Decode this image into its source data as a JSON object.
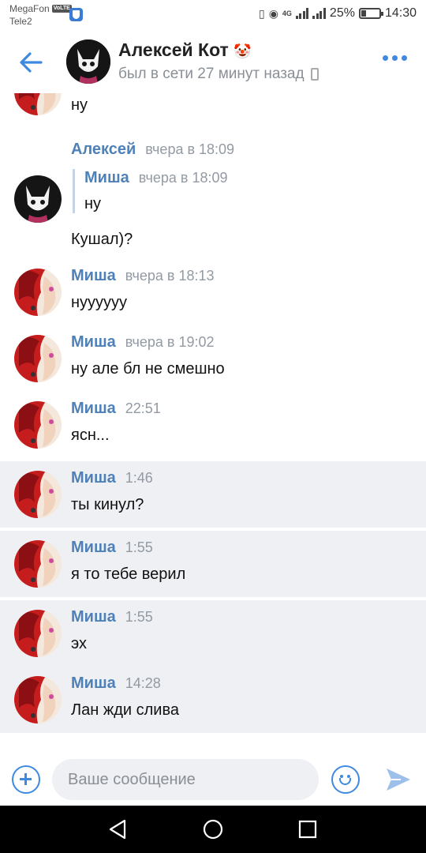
{
  "status_bar": {
    "carrier1": "MegaFon",
    "carrier1_badge": "VoLTE",
    "carrier2": "Tele2",
    "network": "4G",
    "battery_text": "25%",
    "battery_level": 0.25,
    "time": "14:30"
  },
  "header": {
    "name": "Алексей Кот",
    "emoji": "🤡",
    "status": "был в сети 27 минут назад"
  },
  "messages": [
    {
      "type": "continuation",
      "text": "ну",
      "avatar": "misha",
      "unread": false
    },
    {
      "type": "message",
      "author": "Алексей",
      "time": "вчера в 18:09",
      "avatar": "aleksey",
      "unread": false,
      "quote": {
        "author": "Миша",
        "time": "вчера в 18:09",
        "text": "ну"
      },
      "text": "Кушал)?"
    },
    {
      "type": "message",
      "author": "Миша",
      "time": "вчера в 18:13",
      "text": "нуууууу",
      "avatar": "misha",
      "unread": false
    },
    {
      "type": "message",
      "author": "Миша",
      "time": "вчера в 19:02",
      "text": "ну але бл не смешно",
      "avatar": "misha",
      "unread": false
    },
    {
      "type": "message",
      "author": "Миша",
      "time": "22:51",
      "text": "ясн...",
      "avatar": "misha",
      "unread": false
    },
    {
      "type": "message",
      "author": "Миша",
      "time": "1:46",
      "text": "ты кинул?",
      "avatar": "misha",
      "unread": true
    },
    {
      "type": "message",
      "author": "Миша",
      "time": "1:55",
      "text": "я то тебе верил",
      "avatar": "misha",
      "unread": true
    },
    {
      "type": "message",
      "author": "Миша",
      "time": "1:55",
      "text": "эх",
      "avatar": "misha",
      "unread": true
    },
    {
      "type": "message",
      "author": "Миша",
      "time": "14:28",
      "text": "Лан жди слива",
      "avatar": "misha",
      "unread": true
    }
  ],
  "composer": {
    "placeholder": "Ваше сообщение",
    "add_icon": "plus-circle-icon",
    "emoji_icon": "smiley-icon",
    "send_icon": "send-icon"
  },
  "colors": {
    "accent": "#3f8ae0",
    "author": "#4e81b8",
    "unread_bg": "#eef0f3"
  }
}
